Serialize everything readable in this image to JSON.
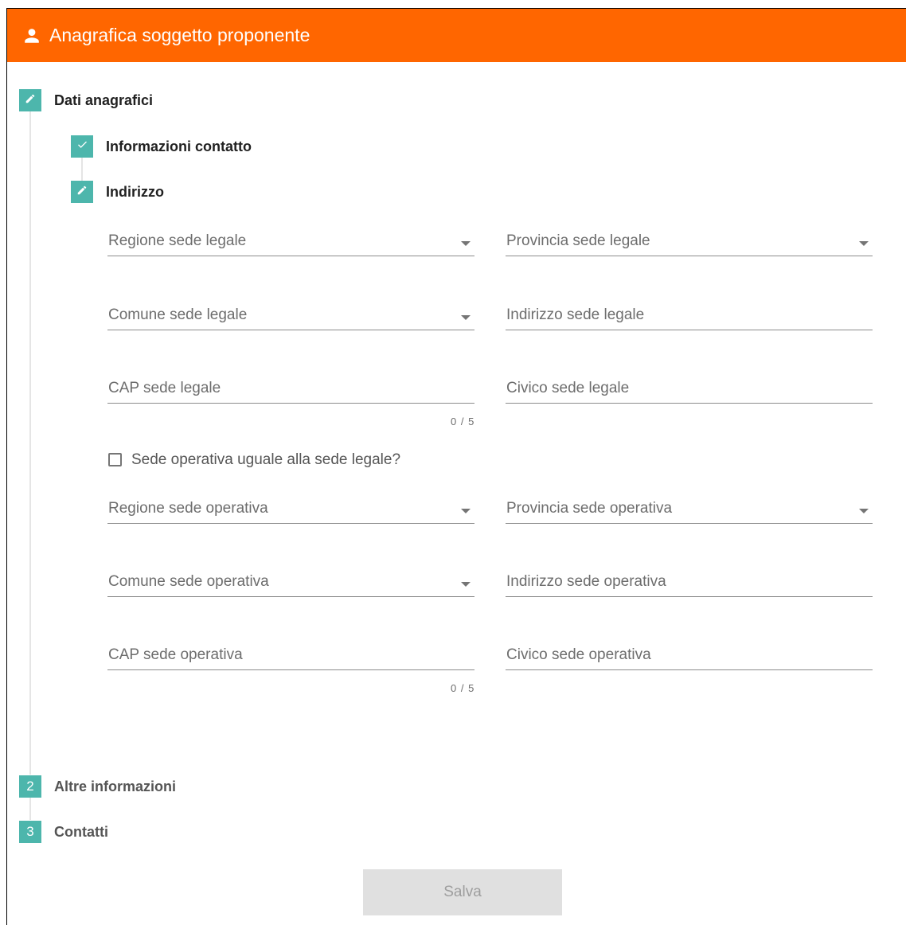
{
  "header": {
    "title": "Anagrafica soggetto proponente",
    "icon": "person-icon"
  },
  "colors": {
    "header": "#ff6600",
    "step": "#4db6ac"
  },
  "steps": [
    {
      "icon": "pencil-icon",
      "label": "Dati anagrafici",
      "state": "editing"
    },
    {
      "number": "2",
      "label": "Altre informazioni",
      "state": "pending"
    },
    {
      "number": "3",
      "label": "Contatti",
      "state": "pending"
    }
  ],
  "substeps": [
    {
      "icon": "check-icon",
      "label": "Informazioni contatto",
      "state": "done"
    },
    {
      "icon": "pencil-icon",
      "label": "Indirizzo",
      "state": "editing"
    }
  ],
  "fields": {
    "regione_legale": "Regione sede legale",
    "provincia_legale": "Provincia sede legale",
    "comune_legale": "Comune sede legale",
    "indirizzo_legale": "Indirizzo sede legale",
    "cap_legale": "CAP sede legale",
    "cap_legale_counter": "0 / 5",
    "civico_legale": "Civico sede legale",
    "same_address_checkbox": "Sede operativa uguale alla sede legale?",
    "regione_operativa": "Regione sede operativa",
    "provincia_operativa": "Provincia sede operativa",
    "comune_operativa": "Comune sede operativa",
    "indirizzo_operativa": "Indirizzo sede operativa",
    "cap_operativa": "CAP sede operativa",
    "cap_operativa_counter": "0 / 5",
    "civico_operativa": "Civico sede operativa"
  },
  "actions": {
    "save_label": "Salva"
  }
}
